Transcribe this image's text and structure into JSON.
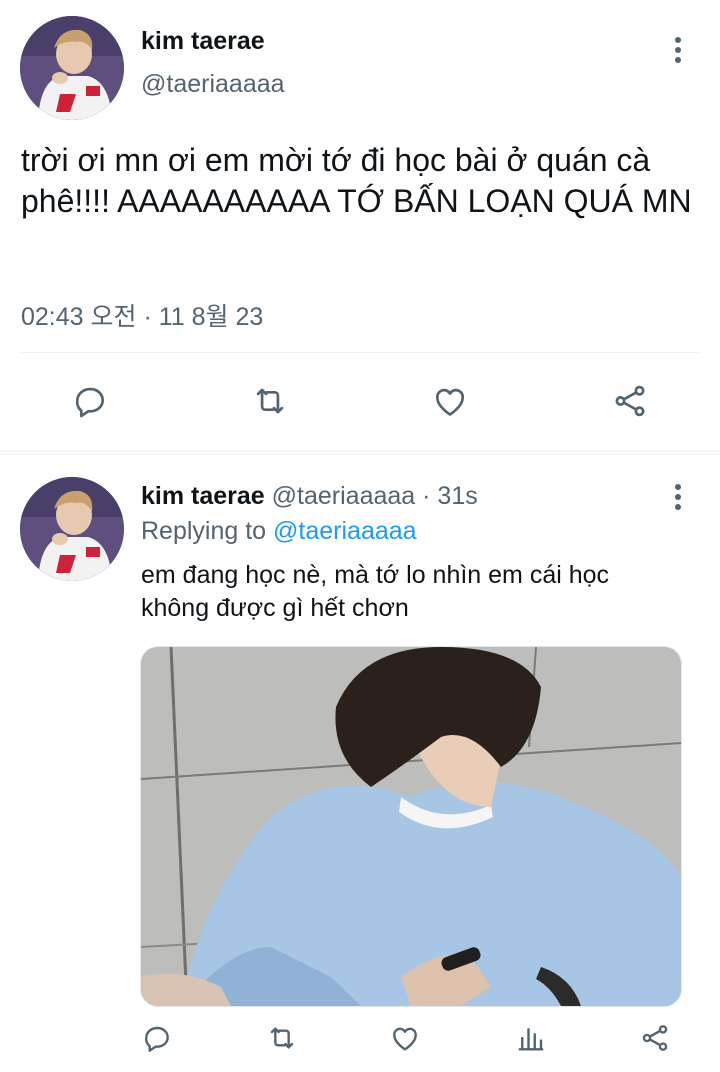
{
  "main_tweet": {
    "author_name": "kim taerae",
    "author_handle": "@taeriaaaaa",
    "text": "trời ơi mn ơi em mời tớ đi học bài ở quán cà phê!!!! AAAAAAAAAA TỚ BẤN LOẠN QUÁ MN",
    "timestamp": "02:43 오전 · 11 8월 23",
    "actions": [
      "reply-icon",
      "retweet-icon",
      "like-icon",
      "share-icon"
    ]
  },
  "reply_tweet": {
    "author_name": "kim taerae",
    "author_handle": "@taeriaaaaa",
    "time_separator": "·",
    "time_ago": "31s",
    "replying_to_label": "Replying to",
    "replying_to_handle": "@taeriaaaaa",
    "text": "em đang học nè, mà tớ lo nhìn em cái học không được gì hết chơn",
    "actions": [
      "reply-icon",
      "retweet-icon",
      "like-icon",
      "analytics-icon",
      "share-icon"
    ]
  },
  "colors": {
    "text": "#0f1419",
    "muted": "#536471",
    "link": "#1d9bf0",
    "divider": "#eff3f4",
    "section_gap": "#f7f9f9"
  }
}
